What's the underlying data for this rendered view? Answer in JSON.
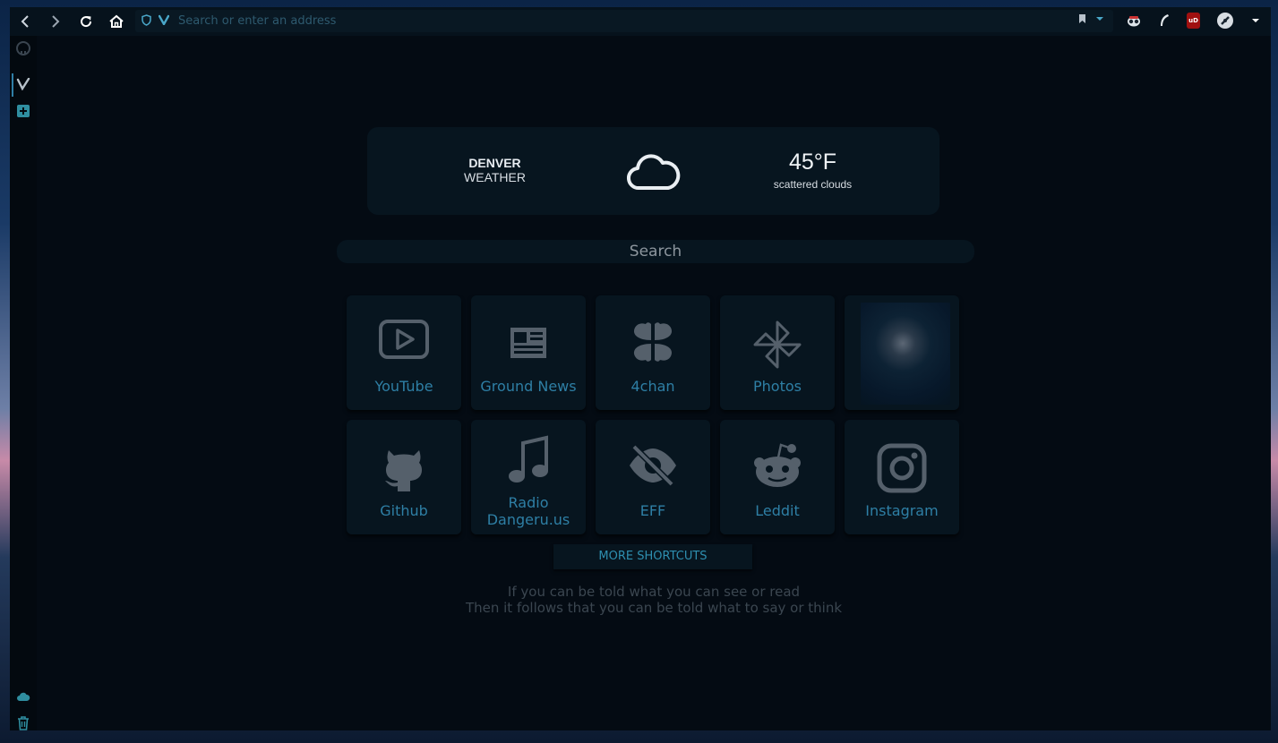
{
  "toolbar": {
    "url_placeholder": "Search or enter an address",
    "extensions": [
      "privacy-badger-icon",
      "feather-icon",
      "ublock-origin-icon",
      "no-tracking-icon"
    ],
    "ublock_text": "uD"
  },
  "sidebar": {
    "panels": [
      "github-icon",
      "vivaldi-icon",
      "add-panel-icon"
    ],
    "bottom": [
      "cloud-sync-icon",
      "trash-icon"
    ]
  },
  "weather": {
    "city": "DENVER",
    "label": "WEATHER",
    "temperature": "45°F",
    "description": "scattered clouds",
    "icon": "cloud-icon"
  },
  "search": {
    "placeholder": "Search"
  },
  "shortcuts": [
    {
      "label": "YouTube",
      "icon": "youtube-icon"
    },
    {
      "label": "Ground News",
      "icon": "newspaper-icon"
    },
    {
      "label": "4chan",
      "icon": "clover-icon"
    },
    {
      "label": "Photos",
      "icon": "pinwheel-icon"
    },
    {
      "label": "",
      "icon": "thumbnail-image"
    },
    {
      "label": "Github",
      "icon": "github-octocat-icon"
    },
    {
      "label": "Radio Dangeru.us",
      "icon": "music-note-icon"
    },
    {
      "label": "EFF",
      "icon": "eye-slash-icon"
    },
    {
      "label": "Leddit",
      "icon": "reddit-icon"
    },
    {
      "label": "Instagram",
      "icon": "instagram-icon"
    }
  ],
  "more_shortcuts": "MORE SHORTCUTS",
  "quote": {
    "line1": "If you can be told what you can see or read",
    "line2": "Then it follows that you can be told what to say or think"
  },
  "colors": {
    "accent": "#2e7fa5",
    "tile_bg": "#07151f",
    "page_bg": "#040b13",
    "icon_gray": "#56606c"
  }
}
